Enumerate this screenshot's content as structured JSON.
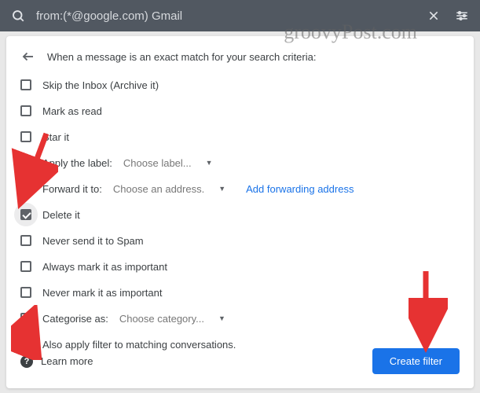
{
  "searchbar": {
    "text": "from:(*@google.com) Gmail"
  },
  "header": {
    "title": "When a message is an exact match for your search criteria:"
  },
  "options": {
    "skip_inbox": "Skip the Inbox (Archive it)",
    "mark_read": "Mark as read",
    "star_it": "Star it",
    "apply_label": "Apply the label:",
    "apply_label_value": "Choose label...",
    "forward_to": "Forward it to:",
    "forward_to_value": "Choose an address.",
    "add_forwarding": "Add forwarding address",
    "delete_it": "Delete it",
    "never_spam": "Never send it to Spam",
    "always_important": "Always mark it as important",
    "never_important": "Never mark it as important",
    "categorise": "Categorise as:",
    "categorise_value": "Choose category...",
    "also_apply": "Also apply filter to matching conversations."
  },
  "footer": {
    "learn_more": "Learn more",
    "create_filter": "Create filter"
  },
  "watermark": "groovyPost.com"
}
